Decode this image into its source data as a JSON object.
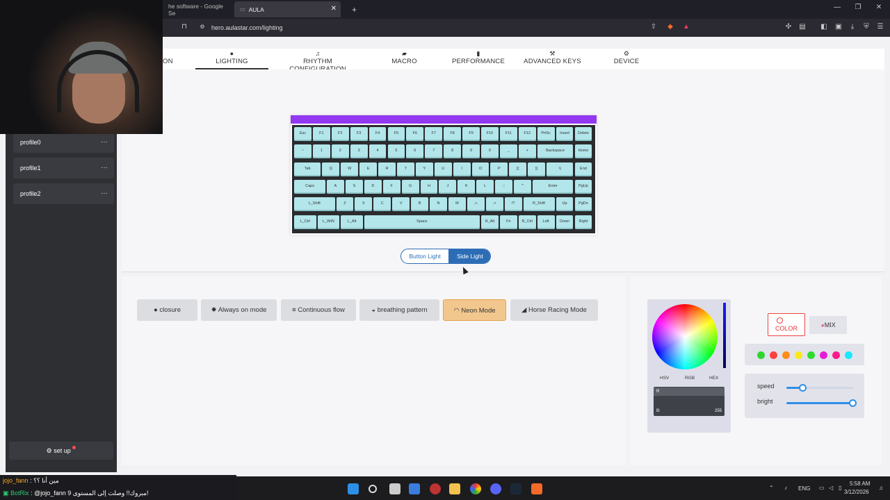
{
  "browser": {
    "tabs": [
      {
        "title": "he software - Google Se"
      },
      {
        "title": "AULA"
      }
    ],
    "new_tab": "+",
    "url": "hero.aulastar.com/lighting",
    "window_controls": {
      "minimize": "—",
      "maximize": "❐",
      "close": "✕"
    }
  },
  "nav": {
    "partial_tab": "ON",
    "tabs": [
      {
        "label": "LIGHTING",
        "icon": "bulb-icon",
        "glyph": "●"
      },
      {
        "label": "RHYTHM CONFIGURATION",
        "icon": "music-note-icon",
        "glyph": "♫"
      },
      {
        "label": "MACRO",
        "icon": "macro-icon",
        "glyph": "▰"
      },
      {
        "label": "PERFORMANCE",
        "icon": "bar-chart-icon",
        "glyph": "▮"
      },
      {
        "label": "ADVANCED KEYS",
        "icon": "wrench-icon",
        "glyph": "⚒"
      },
      {
        "label": "DEVICE",
        "icon": "gear-icon",
        "glyph": "⚙"
      }
    ]
  },
  "sidebar": {
    "profiles": [
      {
        "name": "profile0",
        "menu": "···"
      },
      {
        "name": "profile1",
        "menu": "···"
      },
      {
        "name": "profile2",
        "menu": "···"
      }
    ],
    "setup_label": "set up",
    "setup_icon": "⚙"
  },
  "keyboard": {
    "strip_color": "#9238f0",
    "rows": [
      [
        "Esc",
        "F1",
        "F2",
        "F3",
        "F4",
        "F5",
        "F6",
        "F7",
        "F8",
        "F9",
        "F10",
        "F11",
        "F12",
        "PrtSc",
        "Insert",
        "Delete"
      ],
      [
        "~",
        "1",
        "2",
        "3",
        "4",
        "5",
        "6",
        "7",
        "8",
        "9",
        "0",
        "_",
        "+",
        "Backspace",
        "Home"
      ],
      [
        "Tab",
        "Q",
        "W",
        "E",
        "R",
        "T",
        "Y",
        "U",
        "I",
        "O",
        "P",
        "[{",
        "]}",
        "\\|",
        "End"
      ],
      [
        "Caps",
        "A",
        "S",
        "D",
        "F",
        "G",
        "H",
        "J",
        "K",
        "L",
        ";:",
        "'\"",
        "Enter",
        "PgUp"
      ],
      [
        "L_Shift",
        "Z",
        "X",
        "C",
        "V",
        "B",
        "N",
        "M",
        ",<",
        ".>",
        "/?",
        "R_Shift",
        "Up",
        "PgDn"
      ],
      [
        "L_Ctrl",
        "L_WIN",
        "L_Alt",
        "Space",
        "R_Alt",
        "Fn",
        "R_Ctrl",
        "Left",
        "Down",
        "Right"
      ]
    ]
  },
  "light_toggle": {
    "button_light": "Button Light",
    "side_light": "Side Light",
    "selected": "side_light"
  },
  "modes": [
    {
      "label": "closure",
      "icon": "●"
    },
    {
      "label": "Always on mode",
      "icon": "✹"
    },
    {
      "label": "Continuous flow",
      "icon": "≡"
    },
    {
      "label": "breathing pattern",
      "icon": "◒"
    },
    {
      "label": "Neon Mode",
      "icon": "◠",
      "selected": true
    },
    {
      "label": "Horse Racing Mode",
      "icon": "◢"
    }
  ],
  "color_picker": {
    "formats": [
      "HSV",
      "RGB",
      "HEX"
    ],
    "rgb": {
      "r_label": "R",
      "g_label": "",
      "b_label": "B:",
      "b_value": "255"
    },
    "color_button": "COLOR",
    "mix_button": "MIX",
    "swatches": [
      "#2ed52e",
      "#ff4040",
      "#ff8c1a",
      "#ffe81a",
      "#2edc2e",
      "#e81ad8",
      "#ff1a8c",
      "#1ae8ff"
    ]
  },
  "sliders": {
    "speed": {
      "label": "speed",
      "value": 0.25
    },
    "bright": {
      "label": "bright",
      "value": 1.0
    }
  },
  "chat": {
    "line1_user": "jojo_fann",
    "line1_text": ": مين أنا ؟؟",
    "line2_user": "BotRix",
    "line2_text": ": @jojo_fann مبروك!! وصلت إلى المستوى 9!"
  },
  "taskbar": {
    "lang": "ENG",
    "time": "5:58 AM",
    "date": "3/12/2026"
  }
}
